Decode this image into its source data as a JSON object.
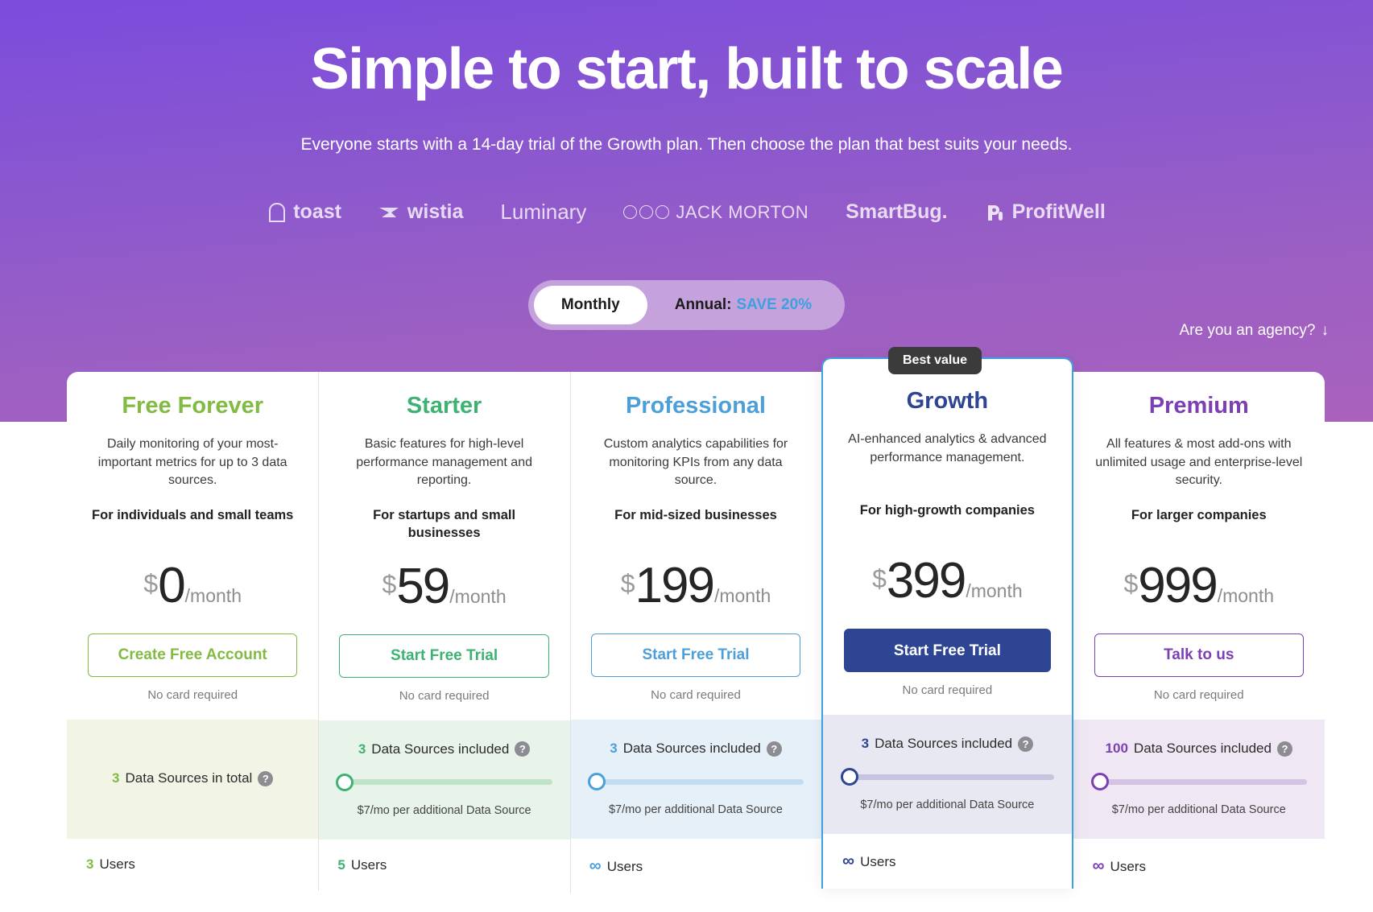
{
  "hero": {
    "title": "Simple to start, built to scale",
    "subtitle": "Everyone starts with a 14-day trial of the Growth plan. Then choose the plan that best suits your needs.",
    "logos": [
      {
        "name": "toast",
        "icon": "toast-icon"
      },
      {
        "name": "wistia",
        "icon": "wistia-icon"
      },
      {
        "name": "Luminary",
        "icon": "none"
      },
      {
        "name": "JACK MORTON",
        "icon": "jack-morton-eyes-icon"
      },
      {
        "name": "SmartBug.",
        "icon": "none"
      },
      {
        "name": "ProfitWell",
        "icon": "profitwell-icon"
      }
    ]
  },
  "billing_toggle": {
    "monthly_label": "Monthly",
    "annual_label": "Annual:",
    "annual_save": "SAVE 20%",
    "selected": "Monthly",
    "save_color": "#3fa0e0"
  },
  "agency_link": {
    "label": "Are you an agency?",
    "icon": "arrow-down-icon",
    "arrow": "↓"
  },
  "badge": {
    "best_value": "Best value"
  },
  "plans": [
    {
      "name": "Free Forever",
      "accent": "#82bb42",
      "description": "Daily monitoring of your most-important metrics for up to 3 data sources.",
      "audience": "For individuals and small teams",
      "currency": "$",
      "price": "0",
      "period": "/month",
      "cta_label": "Create Free Account",
      "cta_style": "outline",
      "no_card": "No card required",
      "featured": false,
      "data_sources": {
        "count": "3",
        "label": "Data Sources in total",
        "has_slider": false,
        "note": "",
        "cell_bg": "#f2f5e6"
      },
      "users": {
        "value": "3",
        "label": "Users",
        "infinite": false
      }
    },
    {
      "name": "Starter",
      "accent": "#3eb273",
      "description": "Basic features for high-level performance management and reporting.",
      "audience": "For startups and small businesses",
      "currency": "$",
      "price": "59",
      "period": "/month",
      "cta_label": "Start Free Trial",
      "cta_style": "outline",
      "no_card": "No card required",
      "featured": false,
      "data_sources": {
        "count": "3",
        "label": "Data Sources included",
        "has_slider": true,
        "note": "$7/mo per additional Data Source",
        "cell_bg": "#e8f3ea",
        "track_color": "#bfe2c9"
      },
      "users": {
        "value": "5",
        "label": "Users",
        "infinite": false
      }
    },
    {
      "name": "Professional",
      "accent": "#4d9fda",
      "description": "Custom analytics capabilities for monitoring KPIs from any data source.",
      "audience": "For mid-sized businesses",
      "currency": "$",
      "price": "199",
      "period": "/month",
      "cta_label": "Start Free Trial",
      "cta_style": "outline",
      "no_card": "No card required",
      "featured": false,
      "data_sources": {
        "count": "3",
        "label": "Data Sources included",
        "has_slider": true,
        "note": "$7/mo per additional Data Source",
        "cell_bg": "#e6f0f9",
        "track_color": "#c3dcf1"
      },
      "users": {
        "value": "∞",
        "label": "Users",
        "infinite": true
      }
    },
    {
      "name": "Growth",
      "accent": "#2e4593",
      "description": "AI-enhanced analytics & advanced performance management.",
      "audience": "For high-growth companies",
      "currency": "$",
      "price": "399",
      "period": "/month",
      "cta_label": "Start Free Trial",
      "cta_style": "filled",
      "no_card": "No card required",
      "featured": true,
      "data_sources": {
        "count": "3",
        "label": "Data Sources included",
        "has_slider": true,
        "note": "$7/mo per additional Data Source",
        "cell_bg": "#e8e8f2",
        "track_color": "#c4c4de"
      },
      "users": {
        "value": "∞",
        "label": "Users",
        "infinite": true
      }
    },
    {
      "name": "Premium",
      "accent": "#7c3fb5",
      "description": "All features & most add-ons with unlimited usage and enterprise-level security.",
      "audience": "For larger companies",
      "currency": "$",
      "price": "999",
      "period": "/month",
      "cta_label": "Talk to us",
      "cta_style": "outline",
      "no_card": "No card required",
      "featured": false,
      "data_sources": {
        "count": "100",
        "label": "Data Sources included",
        "has_slider": true,
        "note": "$7/mo per additional Data Source",
        "cell_bg": "#efe7f3",
        "track_color": "#d4c3e2"
      },
      "users": {
        "value": "∞",
        "label": "Users",
        "infinite": true
      }
    }
  ]
}
